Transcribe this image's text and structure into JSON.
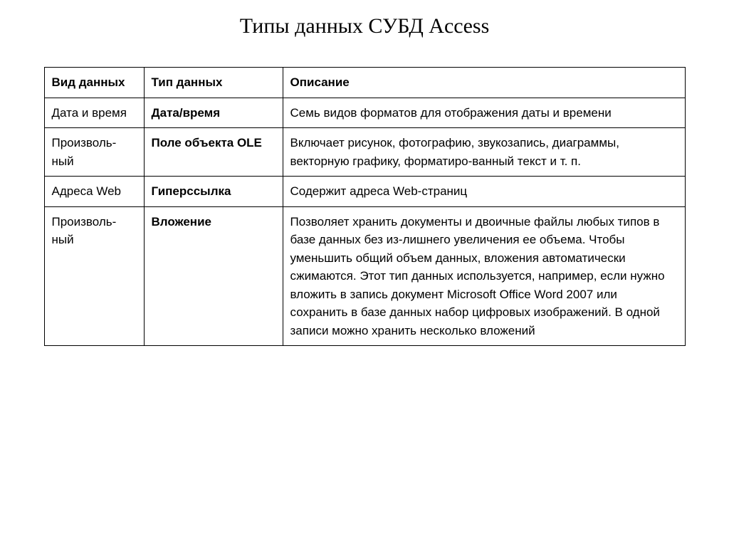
{
  "title": "Типы данных СУБД Access",
  "headers": {
    "col0": "Вид данных",
    "col1": "Тип данных",
    "col2": "Описание"
  },
  "rows": [
    {
      "kind": "Дата и время",
      "type": "Дата/время",
      "desc": "Семь видов форматов для отображения даты и времени"
    },
    {
      "kind": "Произволь-ный",
      "type": "Поле объекта OLE",
      "desc": "Включает рисунок, фотографию, звукозапись, диаграммы, векторную графику, форматиро-ванный текст и т. п."
    },
    {
      "kind": "Адреса Web",
      "type": "Гиперссылка",
      "desc": "Содержит адреса Web-страниц"
    },
    {
      "kind": "Произволь-ный",
      "type": "Вложение",
      "desc": "Позволяет хранить документы и двоичные файлы любых типов в базе данных без из-лишнего увеличения ее объема. Чтобы уменьшить общий объем данных, вложения автоматически сжимаются. Этот тип данных используется, например, если нужно вложить в запись документ Microsoft Office Word 2007 или сохранить в базе данных набор цифровых изображений. В одной записи можно хранить несколько вложений"
    }
  ]
}
